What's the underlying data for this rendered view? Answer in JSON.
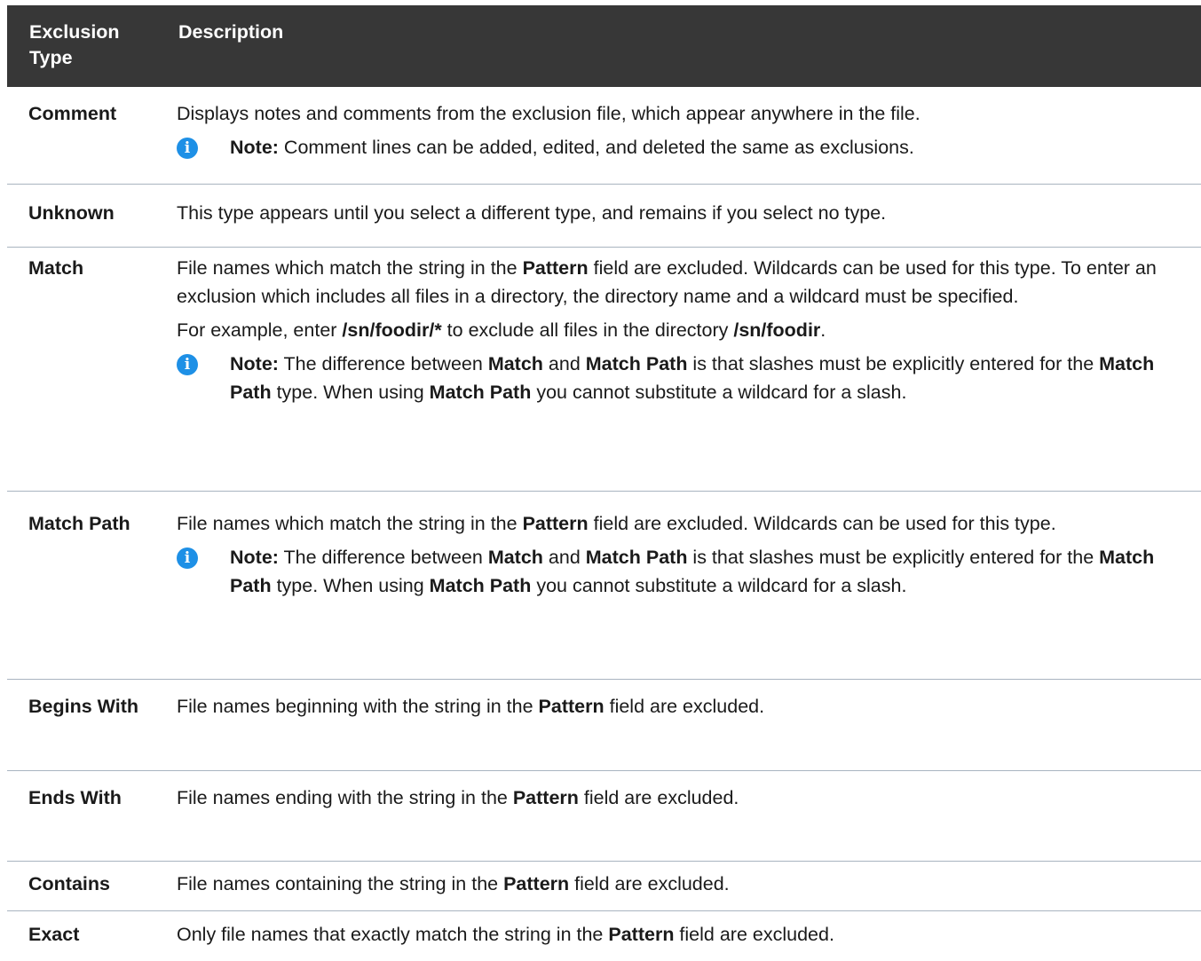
{
  "header": {
    "col1": "Exclusion Type",
    "col2": "Description"
  },
  "rows": [
    {
      "type": "Comment",
      "desc": "Displays notes and comments from the exclusion file, which appear anywhere in the file.",
      "note_label": "Note:",
      "note": " Comment lines can be added, edited, and deleted the same as exclusions."
    },
    {
      "type": "Unknown",
      "desc": "This type appears until you select a different type, and remains if you select no type."
    },
    {
      "type": "Match",
      "desc_a": "File names which match the string in the ",
      "desc_b": "Pattern",
      "desc_c": " field are excluded. Wildcards can be used for this type. To enter an exclusion which includes all files in a directory, the directory name and a wildcard must be specified.",
      "ex_a": "For example, enter ",
      "ex_b": "/sn/foodir/*",
      "ex_c": " to exclude all files in the directory ",
      "ex_d": "/sn/foodir",
      "ex_e": ".",
      "note_label": "Note:",
      "n1": " The difference between ",
      "n2": "Match",
      "n3": " and ",
      "n4": "Match Path",
      "n5": " is that slashes must be explicitly entered for the ",
      "n6": "Match Path",
      "n7": " type. When using ",
      "n8": "Match Path",
      "n9": " you cannot substitute a wildcard for a slash."
    },
    {
      "type": "Match Path",
      "desc_a": "File names which match the string in the ",
      "desc_b": "Pattern",
      "desc_c": " field are excluded. Wildcards can be used for this type.",
      "note_label": "Note:",
      "n1": " The difference between ",
      "n2": "Match",
      "n3": " and ",
      "n4": "Match Path",
      "n5": " is that slashes must be explicitly entered for the ",
      "n6": "Match Path",
      "n7": " type. When using ",
      "n8": "Match Path",
      "n9": " you cannot substitute a wildcard for a slash."
    },
    {
      "type": "Begins With",
      "desc_a": "File names beginning with the string in the ",
      "desc_b": "Pattern",
      "desc_c": " field are excluded."
    },
    {
      "type": "Ends With",
      "desc_a": "File names ending with the string in the ",
      "desc_b": "Pattern",
      "desc_c": " field are excluded."
    },
    {
      "type": "Contains",
      "desc_a": "File names containing the string in the ",
      "desc_b": "Pattern",
      "desc_c": " field are excluded."
    },
    {
      "type": "Exact",
      "desc_a": "Only file names that exactly match the string in the ",
      "desc_b": "Pattern",
      "desc_c": " field are excluded."
    }
  ],
  "icons": {
    "note": "info-icon",
    "note_glyph": "i",
    "note_color": "#1e90e6"
  }
}
